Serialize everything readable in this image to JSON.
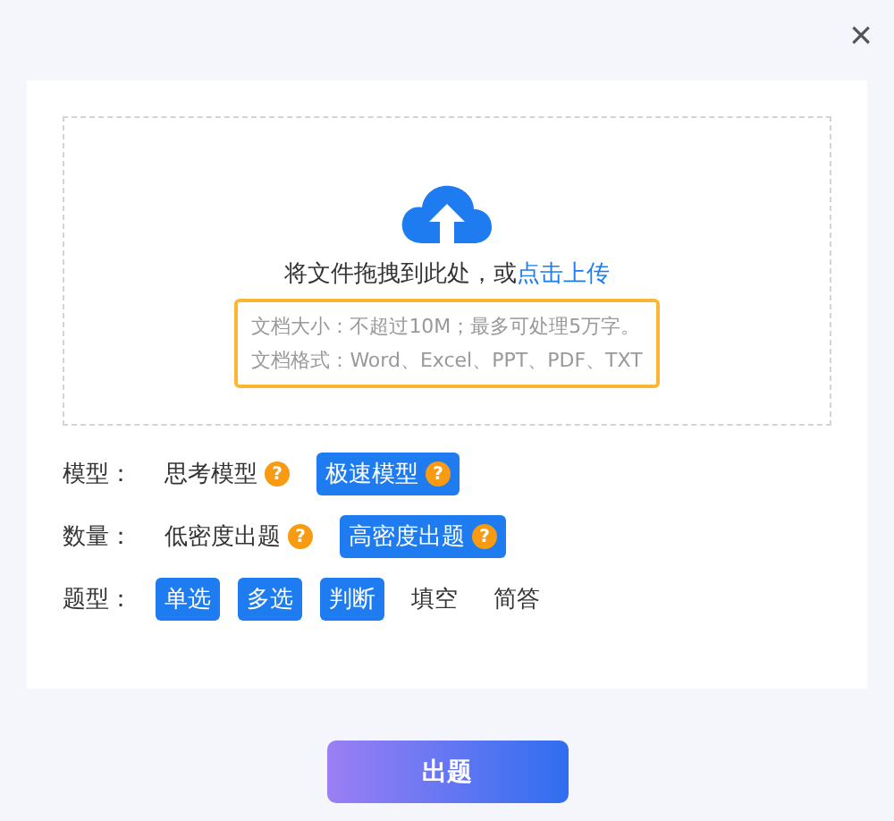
{
  "close": "×",
  "upload": {
    "prompt": "将文件拖拽到此处，或",
    "link": "点击上传",
    "notes": [
      "文档大小：不超过10M；最多可处理5万字。",
      "文档格式：Word、Excel、PPT、PDF、TXT"
    ]
  },
  "settings": [
    {
      "label": "模型：",
      "options": [
        {
          "text": "思考模型",
          "hint": "?",
          "selected": false
        },
        {
          "text": "极速模型",
          "hint": "?",
          "selected": true
        }
      ]
    },
    {
      "label": "数量：",
      "options": [
        {
          "text": "低密度出题",
          "hint": "?",
          "selected": false
        },
        {
          "text": "高密度出题",
          "hint": "?",
          "selected": true
        }
      ]
    },
    {
      "label": "题型：",
      "options": [
        {
          "text": "单选",
          "selected": true
        },
        {
          "text": "多选",
          "selected": true
        },
        {
          "text": "判断",
          "selected": true
        },
        {
          "text": "填空",
          "selected": false
        },
        {
          "text": "简答",
          "selected": false
        }
      ]
    }
  ],
  "submit": "出题"
}
